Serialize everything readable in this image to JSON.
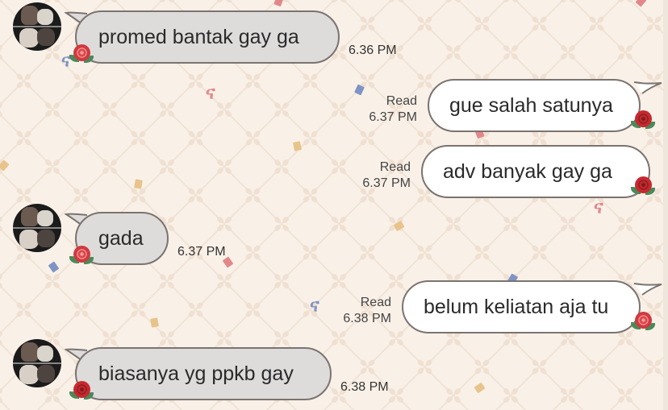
{
  "chat": {
    "messages": [
      {
        "side": "in",
        "text": "promed bantak gay ga",
        "time": "6.36 PM"
      },
      {
        "side": "out",
        "text": "gue salah satunya",
        "read": "Read",
        "time": "6.37 PM"
      },
      {
        "side": "out",
        "text": "adv banyak gay ga",
        "read": "Read",
        "time": "6.37 PM"
      },
      {
        "side": "in",
        "text": "gada",
        "time": "6.37 PM"
      },
      {
        "side": "out",
        "text": "belum keliatan aja tu",
        "read": "Read",
        "time": "6.38 PM"
      },
      {
        "side": "in",
        "text": "biasanya yg ppkb gay",
        "time": "6.38 PM"
      }
    ]
  },
  "theme": {
    "background": "#f9f1e8",
    "incoming_bubble": "#dedcdb",
    "outgoing_bubble": "#ffffff",
    "bubble_border": "#7a7370",
    "decoration_icons": [
      "rose-sticker-icon",
      "confetti-icon"
    ]
  }
}
